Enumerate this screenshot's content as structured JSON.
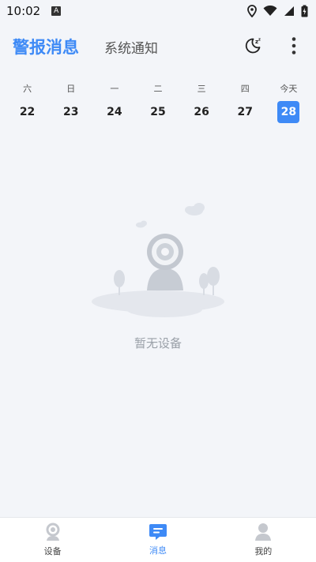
{
  "statusbar": {
    "time": "10:02",
    "notif_badge": "A"
  },
  "header": {
    "tab_alerts": "警报消息",
    "tab_system": "系统通知",
    "icons": [
      "night-mode-icon",
      "more-icon"
    ]
  },
  "week": [
    {
      "label": "六",
      "date": "22"
    },
    {
      "label": "日",
      "date": "23"
    },
    {
      "label": "一",
      "date": "24"
    },
    {
      "label": "二",
      "date": "25"
    },
    {
      "label": "三",
      "date": "26"
    },
    {
      "label": "四",
      "date": "27"
    },
    {
      "label": "今天",
      "date": "28",
      "selected": true
    }
  ],
  "empty": {
    "text": "暂无设备"
  },
  "bottomnav": [
    {
      "label": "设备",
      "icon": "camera-icon",
      "active": false
    },
    {
      "label": "消息",
      "icon": "message-icon",
      "active": true
    },
    {
      "label": "我的",
      "icon": "user-icon",
      "active": false
    }
  ],
  "colors": {
    "accent": "#3e8af6",
    "background": "#f3f5f9"
  }
}
